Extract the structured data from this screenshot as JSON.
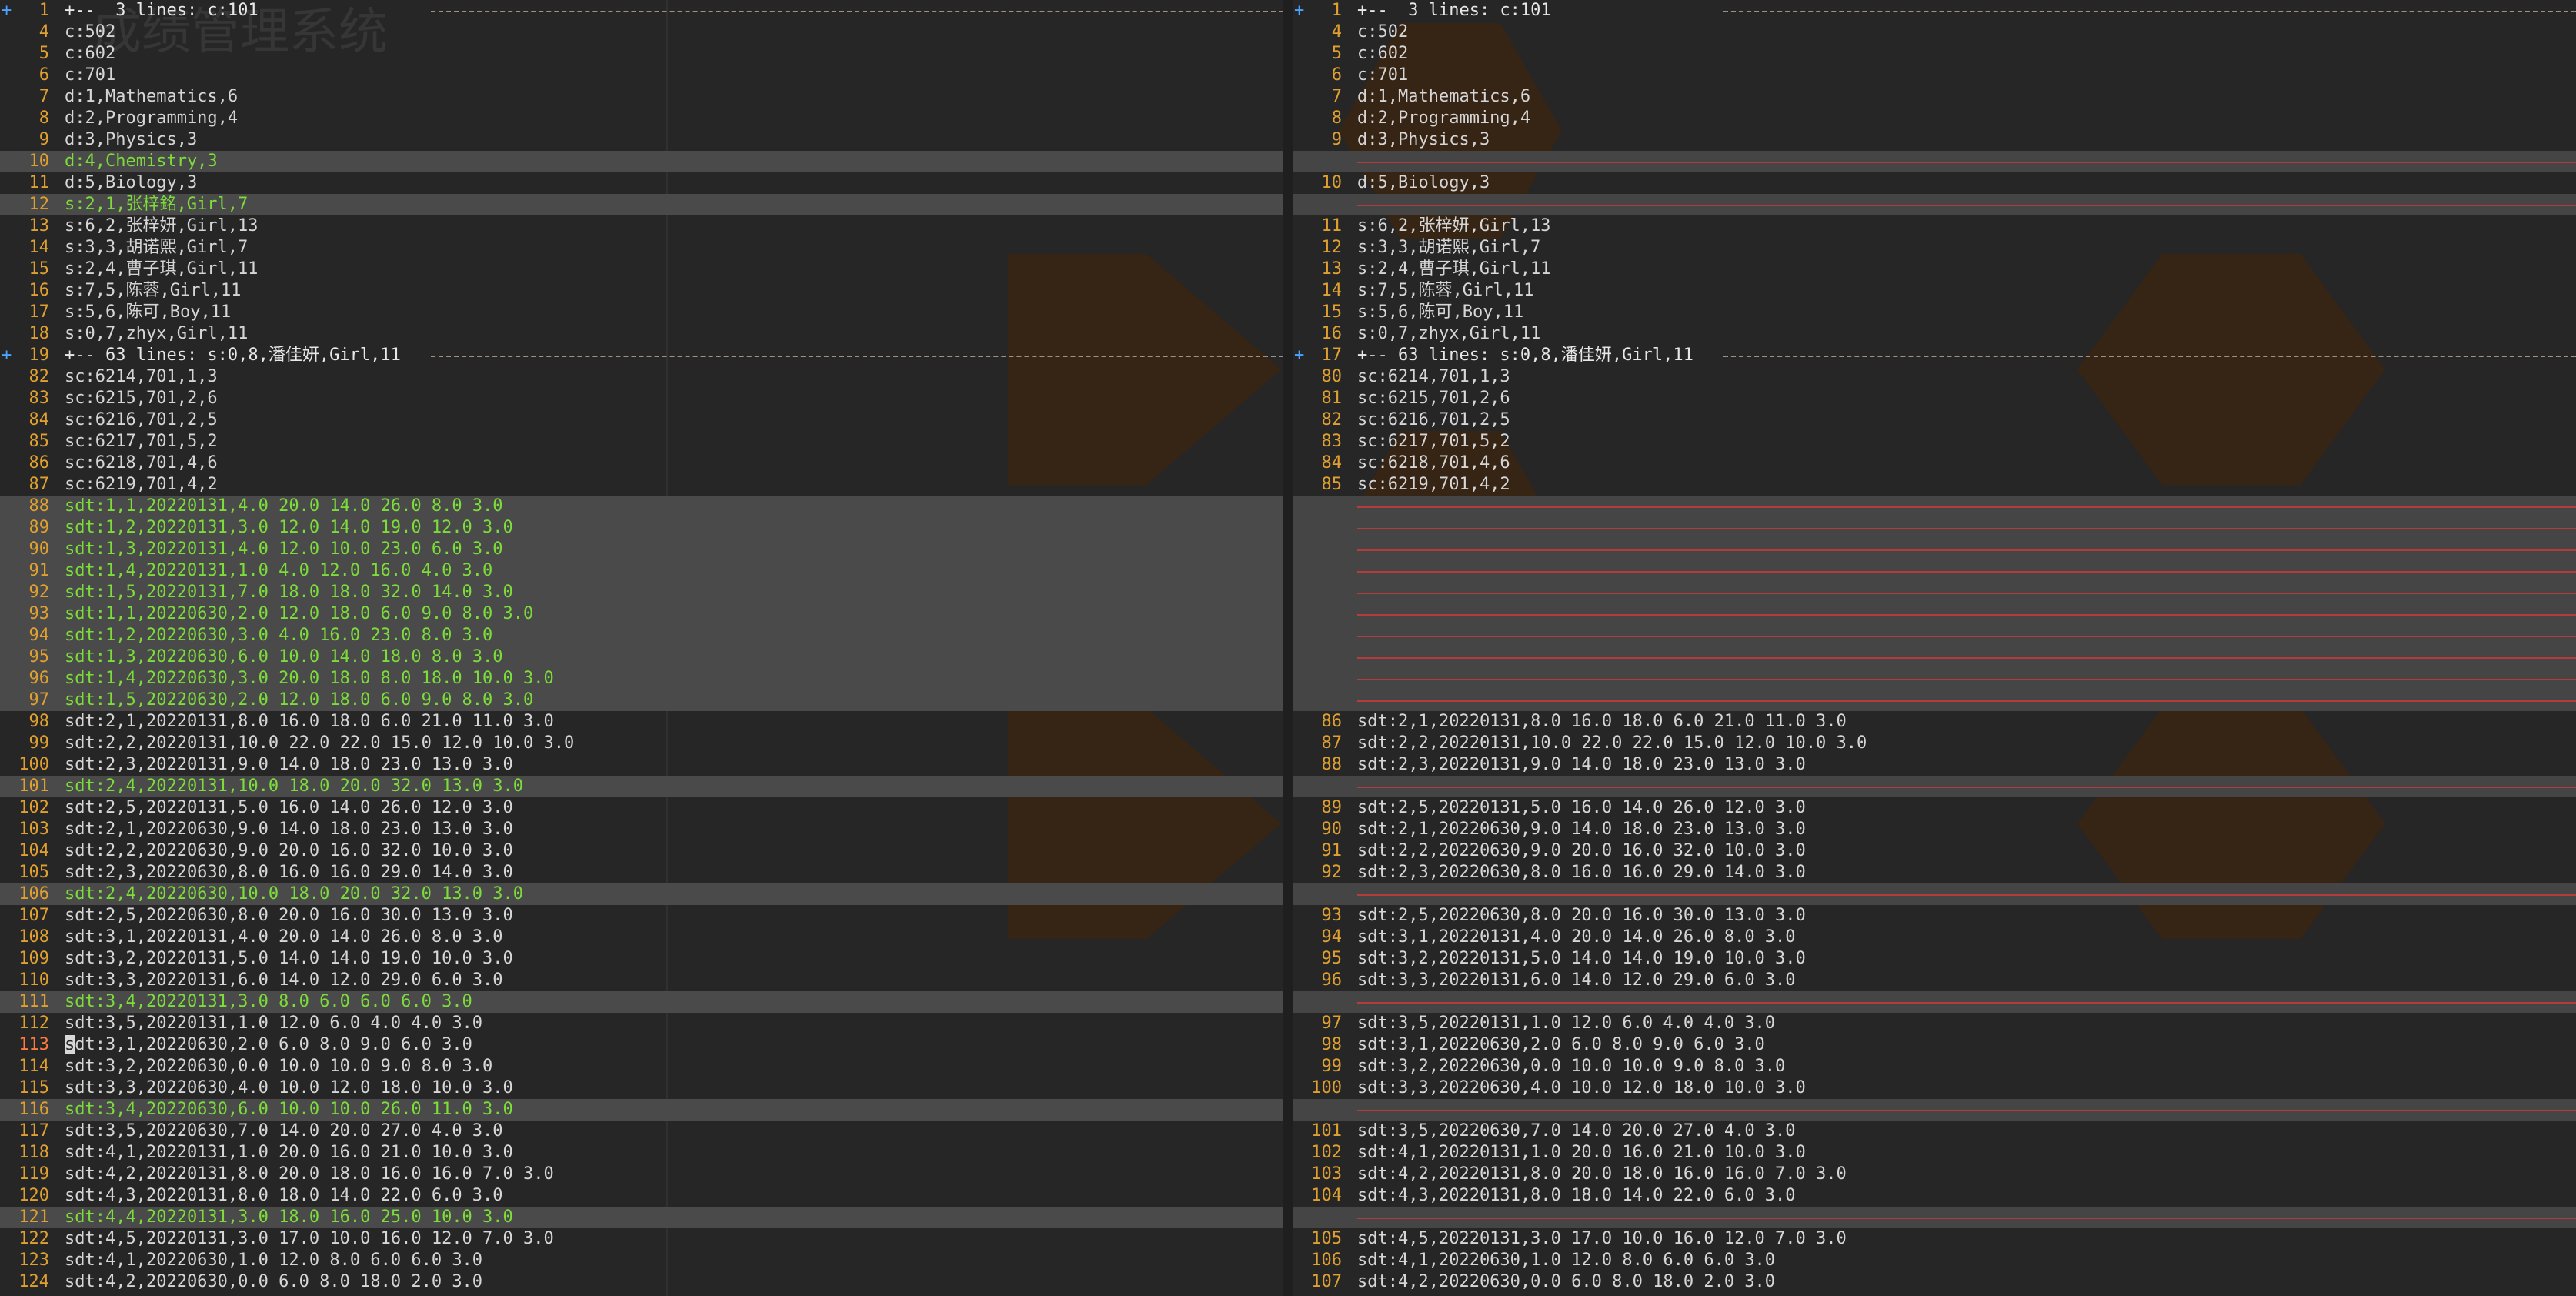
{
  "left": {
    "lines": [
      {
        "kind": "fold",
        "num": "1",
        "text": "+--  3 lines: c:101"
      },
      {
        "kind": "ctx",
        "num": "4",
        "text": "c:502"
      },
      {
        "kind": "ctx",
        "num": "5",
        "text": "c:602"
      },
      {
        "kind": "ctx",
        "num": "6",
        "text": "c:701"
      },
      {
        "kind": "ctx",
        "num": "7",
        "text": "d:1,Mathematics,6"
      },
      {
        "kind": "ctx",
        "num": "8",
        "text": "d:2,Programming,4"
      },
      {
        "kind": "ctx",
        "num": "9",
        "text": "d:3,Physics,3"
      },
      {
        "kind": "added",
        "num": "10",
        "text": "d:4,Chemistry,3"
      },
      {
        "kind": "ctx",
        "num": "11",
        "text": "d:5,Biology,3"
      },
      {
        "kind": "added",
        "num": "12",
        "text": "s:2,1,张梓銘,Girl,7"
      },
      {
        "kind": "ctx",
        "num": "13",
        "text": "s:6,2,张梓妍,Girl,13"
      },
      {
        "kind": "ctx",
        "num": "14",
        "text": "s:3,3,胡诺熙,Girl,7"
      },
      {
        "kind": "ctx",
        "num": "15",
        "text": "s:2,4,曹子琪,Girl,11"
      },
      {
        "kind": "ctx",
        "num": "16",
        "text": "s:7,5,陈蓉,Girl,11"
      },
      {
        "kind": "ctx",
        "num": "17",
        "text": "s:5,6,陈可,Boy,11"
      },
      {
        "kind": "ctx",
        "num": "18",
        "text": "s:0,7,zhyx,Girl,11"
      },
      {
        "kind": "fold",
        "num": "19",
        "text": "+-- 63 lines: s:0,8,潘佳妍,Girl,11"
      },
      {
        "kind": "ctx",
        "num": "82",
        "text": "sc:6214,701,1,3"
      },
      {
        "kind": "ctx",
        "num": "83",
        "text": "sc:6215,701,2,6"
      },
      {
        "kind": "ctx",
        "num": "84",
        "text": "sc:6216,701,2,5"
      },
      {
        "kind": "ctx",
        "num": "85",
        "text": "sc:6217,701,5,2"
      },
      {
        "kind": "ctx",
        "num": "86",
        "text": "sc:6218,701,4,6"
      },
      {
        "kind": "ctx",
        "num": "87",
        "text": "sc:6219,701,4,2"
      },
      {
        "kind": "added",
        "num": "88",
        "text": "sdt:1,1,20220131,4.0 20.0 14.0 26.0 8.0 3.0"
      },
      {
        "kind": "added",
        "num": "89",
        "text": "sdt:1,2,20220131,3.0 12.0 14.0 19.0 12.0 3.0"
      },
      {
        "kind": "added",
        "num": "90",
        "text": "sdt:1,3,20220131,4.0 12.0 10.0 23.0 6.0 3.0"
      },
      {
        "kind": "added",
        "num": "91",
        "text": "sdt:1,4,20220131,1.0 4.0 12.0 16.0 4.0 3.0"
      },
      {
        "kind": "added",
        "num": "92",
        "text": "sdt:1,5,20220131,7.0 18.0 18.0 32.0 14.0 3.0"
      },
      {
        "kind": "added",
        "num": "93",
        "text": "sdt:1,1,20220630,2.0 12.0 18.0 6.0 9.0 8.0 3.0"
      },
      {
        "kind": "added",
        "num": "94",
        "text": "sdt:1,2,20220630,3.0 4.0 16.0 23.0 8.0 3.0"
      },
      {
        "kind": "added",
        "num": "95",
        "text": "sdt:1,3,20220630,6.0 10.0 14.0 18.0 8.0 3.0"
      },
      {
        "kind": "added",
        "num": "96",
        "text": "sdt:1,4,20220630,3.0 20.0 18.0 8.0 18.0 10.0 3.0"
      },
      {
        "kind": "added",
        "num": "97",
        "text": "sdt:1,5,20220630,2.0 12.0 18.0 6.0 9.0 8.0 3.0"
      },
      {
        "kind": "ctx",
        "num": "98",
        "text": "sdt:2,1,20220131,8.0 16.0 18.0 6.0 21.0 11.0 3.0"
      },
      {
        "kind": "ctx",
        "num": "99",
        "text": "sdt:2,2,20220131,10.0 22.0 22.0 15.0 12.0 10.0 3.0"
      },
      {
        "kind": "ctx",
        "num": "100",
        "text": "sdt:2,3,20220131,9.0 14.0 18.0 23.0 13.0 3.0"
      },
      {
        "kind": "added",
        "num": "101",
        "text": "sdt:2,4,20220131,10.0 18.0 20.0 32.0 13.0 3.0"
      },
      {
        "kind": "ctx",
        "num": "102",
        "text": "sdt:2,5,20220131,5.0 16.0 14.0 26.0 12.0 3.0"
      },
      {
        "kind": "ctx",
        "num": "103",
        "text": "sdt:2,1,20220630,9.0 14.0 18.0 23.0 13.0 3.0"
      },
      {
        "kind": "ctx",
        "num": "104",
        "text": "sdt:2,2,20220630,9.0 20.0 16.0 32.0 10.0 3.0"
      },
      {
        "kind": "ctx",
        "num": "105",
        "text": "sdt:2,3,20220630,8.0 16.0 16.0 29.0 14.0 3.0"
      },
      {
        "kind": "added",
        "num": "106",
        "text": "sdt:2,4,20220630,10.0 18.0 20.0 32.0 13.0 3.0"
      },
      {
        "kind": "ctx",
        "num": "107",
        "text": "sdt:2,5,20220630,8.0 20.0 16.0 30.0 13.0 3.0"
      },
      {
        "kind": "ctx",
        "num": "108",
        "text": "sdt:3,1,20220131,4.0 20.0 14.0 26.0 8.0 3.0"
      },
      {
        "kind": "ctx",
        "num": "109",
        "text": "sdt:3,2,20220131,5.0 14.0 14.0 19.0 10.0 3.0"
      },
      {
        "kind": "ctx",
        "num": "110",
        "text": "sdt:3,3,20220131,6.0 14.0 12.0 29.0 6.0 3.0"
      },
      {
        "kind": "added",
        "num": "111",
        "text": "sdt:3,4,20220131,3.0 8.0 6.0 6.0 6.0 3.0"
      },
      {
        "kind": "ctx",
        "num": "112",
        "text": "sdt:3,5,20220131,1.0 12.0 6.0 4.0 4.0 3.0"
      },
      {
        "kind": "ctx",
        "num": "113",
        "text": "sdt:3,1,20220630,2.0 6.0 8.0 9.0 6.0 3.0",
        "cursor": true
      },
      {
        "kind": "ctx",
        "num": "114",
        "text": "sdt:3,2,20220630,0.0 10.0 10.0 9.0 8.0 3.0"
      },
      {
        "kind": "ctx",
        "num": "115",
        "text": "sdt:3,3,20220630,4.0 10.0 12.0 18.0 10.0 3.0"
      },
      {
        "kind": "added",
        "num": "116",
        "text": "sdt:3,4,20220630,6.0 10.0 10.0 26.0 11.0 3.0"
      },
      {
        "kind": "ctx",
        "num": "117",
        "text": "sdt:3,5,20220630,7.0 14.0 20.0 27.0 4.0 3.0"
      },
      {
        "kind": "ctx",
        "num": "118",
        "text": "sdt:4,1,20220131,1.0 20.0 16.0 21.0 10.0 3.0"
      },
      {
        "kind": "ctx",
        "num": "119",
        "text": "sdt:4,2,20220131,8.0 20.0 18.0 16.0 16.0 7.0 3.0"
      },
      {
        "kind": "ctx",
        "num": "120",
        "text": "sdt:4,3,20220131,8.0 18.0 14.0 22.0 6.0 3.0"
      },
      {
        "kind": "added",
        "num": "121",
        "text": "sdt:4,4,20220131,3.0 18.0 16.0 25.0 10.0 3.0"
      },
      {
        "kind": "ctx",
        "num": "122",
        "text": "sdt:4,5,20220131,3.0 17.0 10.0 16.0 12.0 7.0 3.0"
      },
      {
        "kind": "ctx",
        "num": "123",
        "text": "sdt:4,1,20220630,1.0 12.0 8.0 6.0 6.0 3.0"
      },
      {
        "kind": "ctx",
        "num": "124",
        "text": "sdt:4,2,20220630,0.0 6.0 8.0 18.0 2.0 3.0"
      }
    ]
  },
  "right": {
    "lines": [
      {
        "kind": "fold",
        "num": "1",
        "text": "+--  3 lines: c:101"
      },
      {
        "kind": "ctx",
        "num": "4",
        "text": "c:502"
      },
      {
        "kind": "ctx",
        "num": "5",
        "text": "c:602"
      },
      {
        "kind": "ctx",
        "num": "6",
        "text": "c:701"
      },
      {
        "kind": "ctx",
        "num": "7",
        "text": "d:1,Mathematics,6"
      },
      {
        "kind": "ctx",
        "num": "8",
        "text": "d:2,Programming,4"
      },
      {
        "kind": "ctx",
        "num": "9",
        "text": "d:3,Physics,3"
      },
      {
        "kind": "filler",
        "num": "",
        "text": ""
      },
      {
        "kind": "ctx",
        "num": "10",
        "text": "d:5,Biology,3"
      },
      {
        "kind": "filler",
        "num": "",
        "text": ""
      },
      {
        "kind": "ctx",
        "num": "11",
        "text": "s:6,2,张梓妍,Girl,13"
      },
      {
        "kind": "ctx",
        "num": "12",
        "text": "s:3,3,胡诺熙,Girl,7"
      },
      {
        "kind": "ctx",
        "num": "13",
        "text": "s:2,4,曹子琪,Girl,11"
      },
      {
        "kind": "ctx",
        "num": "14",
        "text": "s:7,5,陈蓉,Girl,11"
      },
      {
        "kind": "ctx",
        "num": "15",
        "text": "s:5,6,陈可,Boy,11"
      },
      {
        "kind": "ctx",
        "num": "16",
        "text": "s:0,7,zhyx,Girl,11"
      },
      {
        "kind": "fold",
        "num": "17",
        "text": "+-- 63 lines: s:0,8,潘佳妍,Girl,11"
      },
      {
        "kind": "ctx",
        "num": "80",
        "text": "sc:6214,701,1,3"
      },
      {
        "kind": "ctx",
        "num": "81",
        "text": "sc:6215,701,2,6"
      },
      {
        "kind": "ctx",
        "num": "82",
        "text": "sc:6216,701,2,5"
      },
      {
        "kind": "ctx",
        "num": "83",
        "text": "sc:6217,701,5,2"
      },
      {
        "kind": "ctx",
        "num": "84",
        "text": "sc:6218,701,4,6"
      },
      {
        "kind": "ctx",
        "num": "85",
        "text": "sc:6219,701,4,2"
      },
      {
        "kind": "filler",
        "num": "",
        "text": ""
      },
      {
        "kind": "filler",
        "num": "",
        "text": ""
      },
      {
        "kind": "filler",
        "num": "",
        "text": ""
      },
      {
        "kind": "filler",
        "num": "",
        "text": ""
      },
      {
        "kind": "filler",
        "num": "",
        "text": ""
      },
      {
        "kind": "filler",
        "num": "",
        "text": ""
      },
      {
        "kind": "filler",
        "num": "",
        "text": ""
      },
      {
        "kind": "filler",
        "num": "",
        "text": ""
      },
      {
        "kind": "filler",
        "num": "",
        "text": ""
      },
      {
        "kind": "filler",
        "num": "",
        "text": ""
      },
      {
        "kind": "ctx",
        "num": "86",
        "text": "sdt:2,1,20220131,8.0 16.0 18.0 6.0 21.0 11.0 3.0"
      },
      {
        "kind": "ctx",
        "num": "87",
        "text": "sdt:2,2,20220131,10.0 22.0 22.0 15.0 12.0 10.0 3.0"
      },
      {
        "kind": "ctx",
        "num": "88",
        "text": "sdt:2,3,20220131,9.0 14.0 18.0 23.0 13.0 3.0"
      },
      {
        "kind": "filler",
        "num": "",
        "text": ""
      },
      {
        "kind": "ctx",
        "num": "89",
        "text": "sdt:2,5,20220131,5.0 16.0 14.0 26.0 12.0 3.0"
      },
      {
        "kind": "ctx",
        "num": "90",
        "text": "sdt:2,1,20220630,9.0 14.0 18.0 23.0 13.0 3.0"
      },
      {
        "kind": "ctx",
        "num": "91",
        "text": "sdt:2,2,20220630,9.0 20.0 16.0 32.0 10.0 3.0"
      },
      {
        "kind": "ctx",
        "num": "92",
        "text": "sdt:2,3,20220630,8.0 16.0 16.0 29.0 14.0 3.0"
      },
      {
        "kind": "filler",
        "num": "",
        "text": ""
      },
      {
        "kind": "ctx",
        "num": "93",
        "text": "sdt:2,5,20220630,8.0 20.0 16.0 30.0 13.0 3.0"
      },
      {
        "kind": "ctx",
        "num": "94",
        "text": "sdt:3,1,20220131,4.0 20.0 14.0 26.0 8.0 3.0"
      },
      {
        "kind": "ctx",
        "num": "95",
        "text": "sdt:3,2,20220131,5.0 14.0 14.0 19.0 10.0 3.0"
      },
      {
        "kind": "ctx",
        "num": "96",
        "text": "sdt:3,3,20220131,6.0 14.0 12.0 29.0 6.0 3.0"
      },
      {
        "kind": "filler",
        "num": "",
        "text": ""
      },
      {
        "kind": "ctx",
        "num": "97",
        "text": "sdt:3,5,20220131,1.0 12.0 6.0 4.0 4.0 3.0"
      },
      {
        "kind": "ctx",
        "num": "98",
        "text": "sdt:3,1,20220630,2.0 6.0 8.0 9.0 6.0 3.0"
      },
      {
        "kind": "ctx",
        "num": "99",
        "text": "sdt:3,2,20220630,0.0 10.0 10.0 9.0 8.0 3.0"
      },
      {
        "kind": "ctx",
        "num": "100",
        "text": "sdt:3,3,20220630,4.0 10.0 12.0 18.0 10.0 3.0"
      },
      {
        "kind": "filler",
        "num": "",
        "text": ""
      },
      {
        "kind": "ctx",
        "num": "101",
        "text": "sdt:3,5,20220630,7.0 14.0 20.0 27.0 4.0 3.0"
      },
      {
        "kind": "ctx",
        "num": "102",
        "text": "sdt:4,1,20220131,1.0 20.0 16.0 21.0 10.0 3.0"
      },
      {
        "kind": "ctx",
        "num": "103",
        "text": "sdt:4,2,20220131,8.0 20.0 18.0 16.0 16.0 7.0 3.0"
      },
      {
        "kind": "ctx",
        "num": "104",
        "text": "sdt:4,3,20220131,8.0 18.0 14.0 22.0 6.0 3.0"
      },
      {
        "kind": "filler",
        "num": "",
        "text": ""
      },
      {
        "kind": "ctx",
        "num": "105",
        "text": "sdt:4,5,20220131,3.0 17.0 10.0 16.0 12.0 7.0 3.0"
      },
      {
        "kind": "ctx",
        "num": "106",
        "text": "sdt:4,1,20220630,1.0 12.0 8.0 6.0 6.0 3.0"
      },
      {
        "kind": "ctx",
        "num": "107",
        "text": "sdt:4,2,20220630,0.0 6.0 8.0 18.0 2.0 3.0"
      }
    ]
  },
  "overlay": {
    "title": "成绩管理系统"
  },
  "colors": {
    "background": "#262626",
    "line_number": "#e0a030",
    "added_text": "#7cdc3a",
    "added_bg": "#4a4a4a",
    "filler_line": "#b33c3c",
    "fold_sign": "#4aa3ff"
  }
}
